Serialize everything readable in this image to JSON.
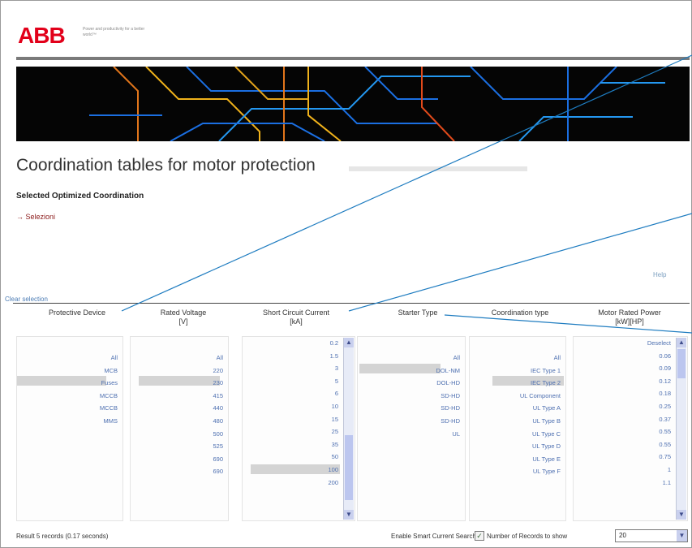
{
  "brand": {
    "logo": "ABB",
    "tagline": "Power and productivity for a better world™"
  },
  "page": {
    "title": "Coordination tables for motor protection",
    "subtitle": "Selected Optimized Coordination",
    "selected_link": "Selezioni",
    "help_link": "Help",
    "clear_link": "Clear selection"
  },
  "columns": [
    {
      "header": "Protective Device",
      "items": [
        "All",
        "MCB",
        "Fuses",
        "MCCB",
        "MCCB",
        "MMS"
      ]
    },
    {
      "header": "Rated Voltage\n[V]",
      "items": [
        "All",
        "220",
        "230",
        "415",
        "440",
        "480",
        "500",
        "525",
        "690",
        "690"
      ]
    },
    {
      "header": "Short Circuit Current\n[kA]",
      "items": [
        "0.2",
        "1.5",
        "3",
        "5",
        "6",
        "10",
        "15",
        "25",
        "35",
        "50",
        "100",
        "200"
      ]
    },
    {
      "header": "Starter Type",
      "items": [
        "All",
        "DOL-NM",
        "DOL-HD",
        "SD-HD",
        "SD-HD",
        "SD-HD",
        "UL"
      ]
    },
    {
      "header": "Coordination type",
      "items": [
        "All",
        "IEC Type 1",
        "IEC Type 2",
        "UL Component",
        "UL Type A",
        "UL Type B",
        "UL Type C",
        "UL Type D",
        "UL Type E",
        "UL Type F"
      ]
    },
    {
      "header": "Motor Rated Power\n[kW][HP]",
      "items": [
        "Deselect",
        "0.06",
        "0.09",
        "0.12",
        "0.18",
        "0.25",
        "0.37",
        "0.55",
        "0.55",
        "0.75",
        "1",
        "1.1"
      ]
    }
  ],
  "footer": {
    "result": "Result 5 records (0.17 seconds)",
    "enable_label": "Enable Smart Current Search",
    "records_label": "Number of Records to show",
    "records_value": "20"
  },
  "colors": {
    "brand_red": "#e2001a",
    "link_blue": "#4d6fb0",
    "callout_blue": "#1e7cc0"
  }
}
